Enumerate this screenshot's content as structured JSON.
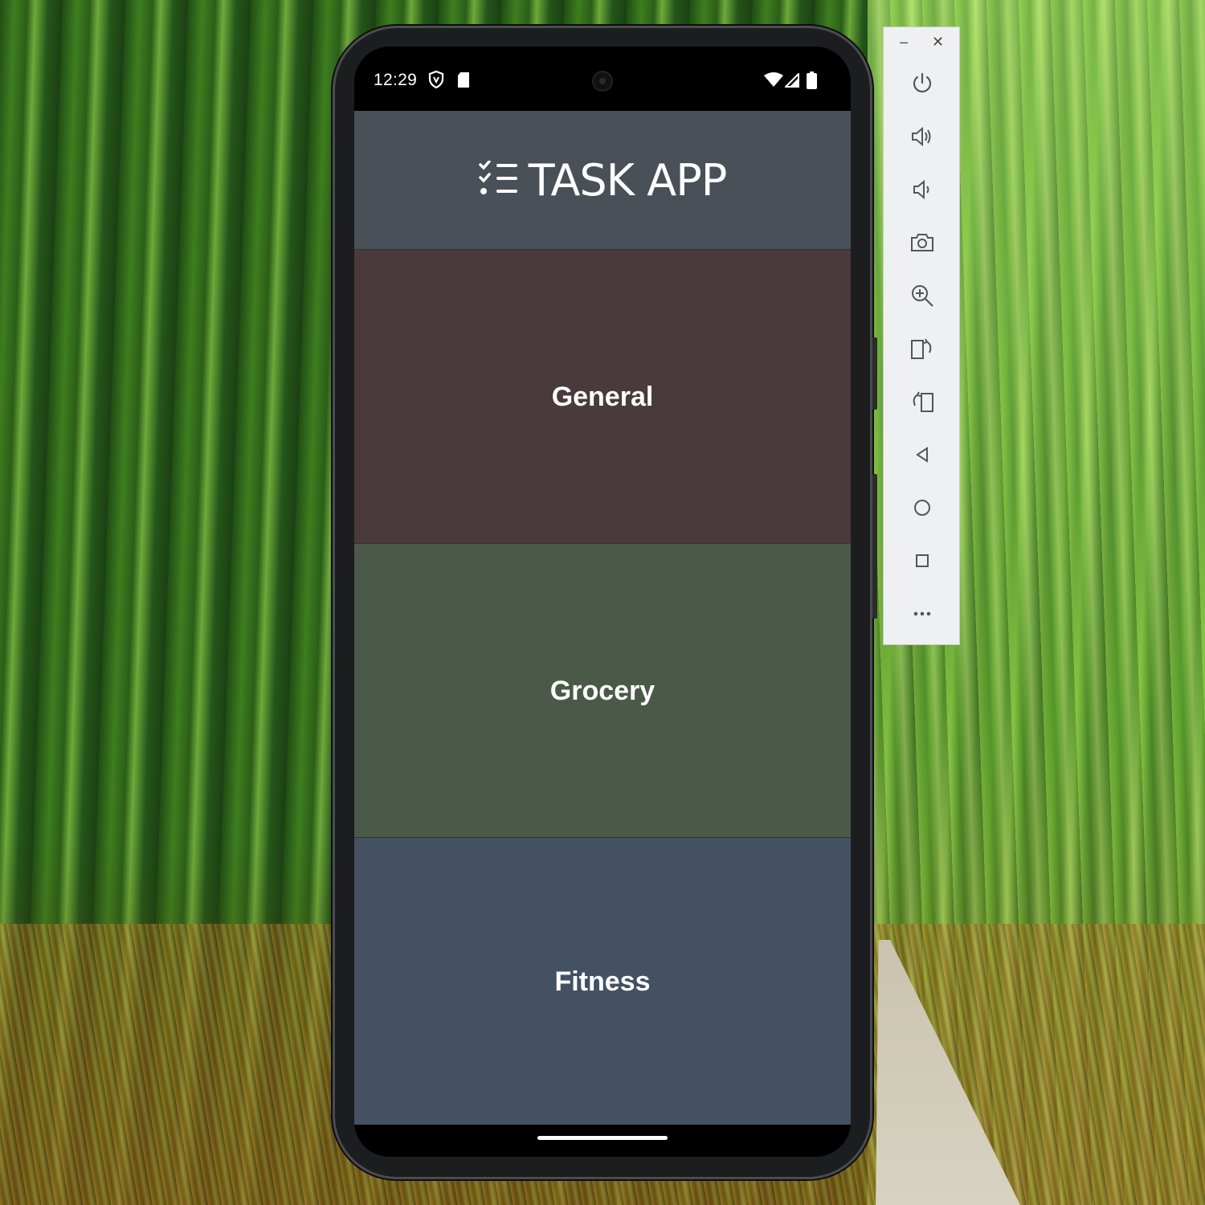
{
  "status_bar": {
    "time": "12:29",
    "left_icons": [
      "shield-icon",
      "sd-card-icon"
    ],
    "right_icons": [
      "wifi-icon",
      "cell-signal-icon",
      "battery-icon"
    ]
  },
  "app": {
    "title": "TASK APP",
    "logo_icon": "checklist-icon",
    "categories": [
      {
        "label": "General",
        "color": "#4a3a3c"
      },
      {
        "label": "Grocery",
        "color": "#4b5949"
      },
      {
        "label": "Fitness",
        "color": "#435163"
      }
    ],
    "header_color": "#495057"
  },
  "emulator_toolbar": {
    "window_controls": [
      "minimize-icon",
      "close-icon"
    ],
    "buttons": [
      "power-icon",
      "volume-up-icon",
      "volume-down-icon",
      "camera-icon",
      "zoom-icon",
      "rotate-right-icon",
      "rotate-left-icon",
      "back-icon",
      "home-icon",
      "overview-icon",
      "more-icon"
    ]
  }
}
